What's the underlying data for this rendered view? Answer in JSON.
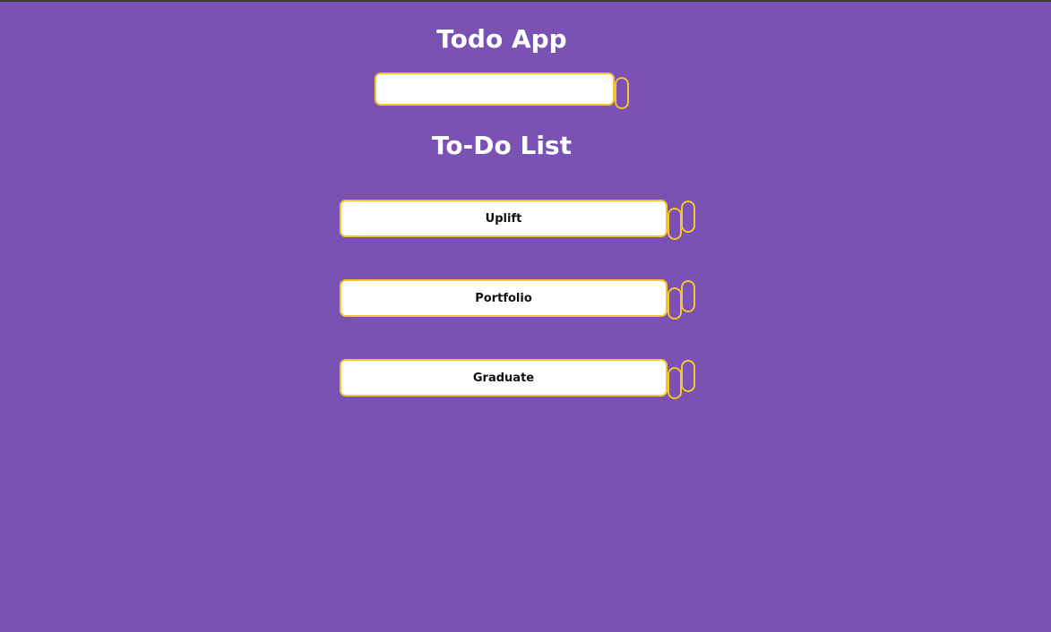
{
  "header": {
    "title": "Todo App"
  },
  "new_todo": {
    "value": "",
    "placeholder": ""
  },
  "list": {
    "title": "To-Do List",
    "items": [
      {
        "label": "Uplift"
      },
      {
        "label": "Portfolio"
      },
      {
        "label": "Graduate"
      }
    ]
  },
  "colors": {
    "background": "#7952b3",
    "accent_border": "#f4c430",
    "text_light": "#ffffff",
    "text_dark": "#111111"
  }
}
